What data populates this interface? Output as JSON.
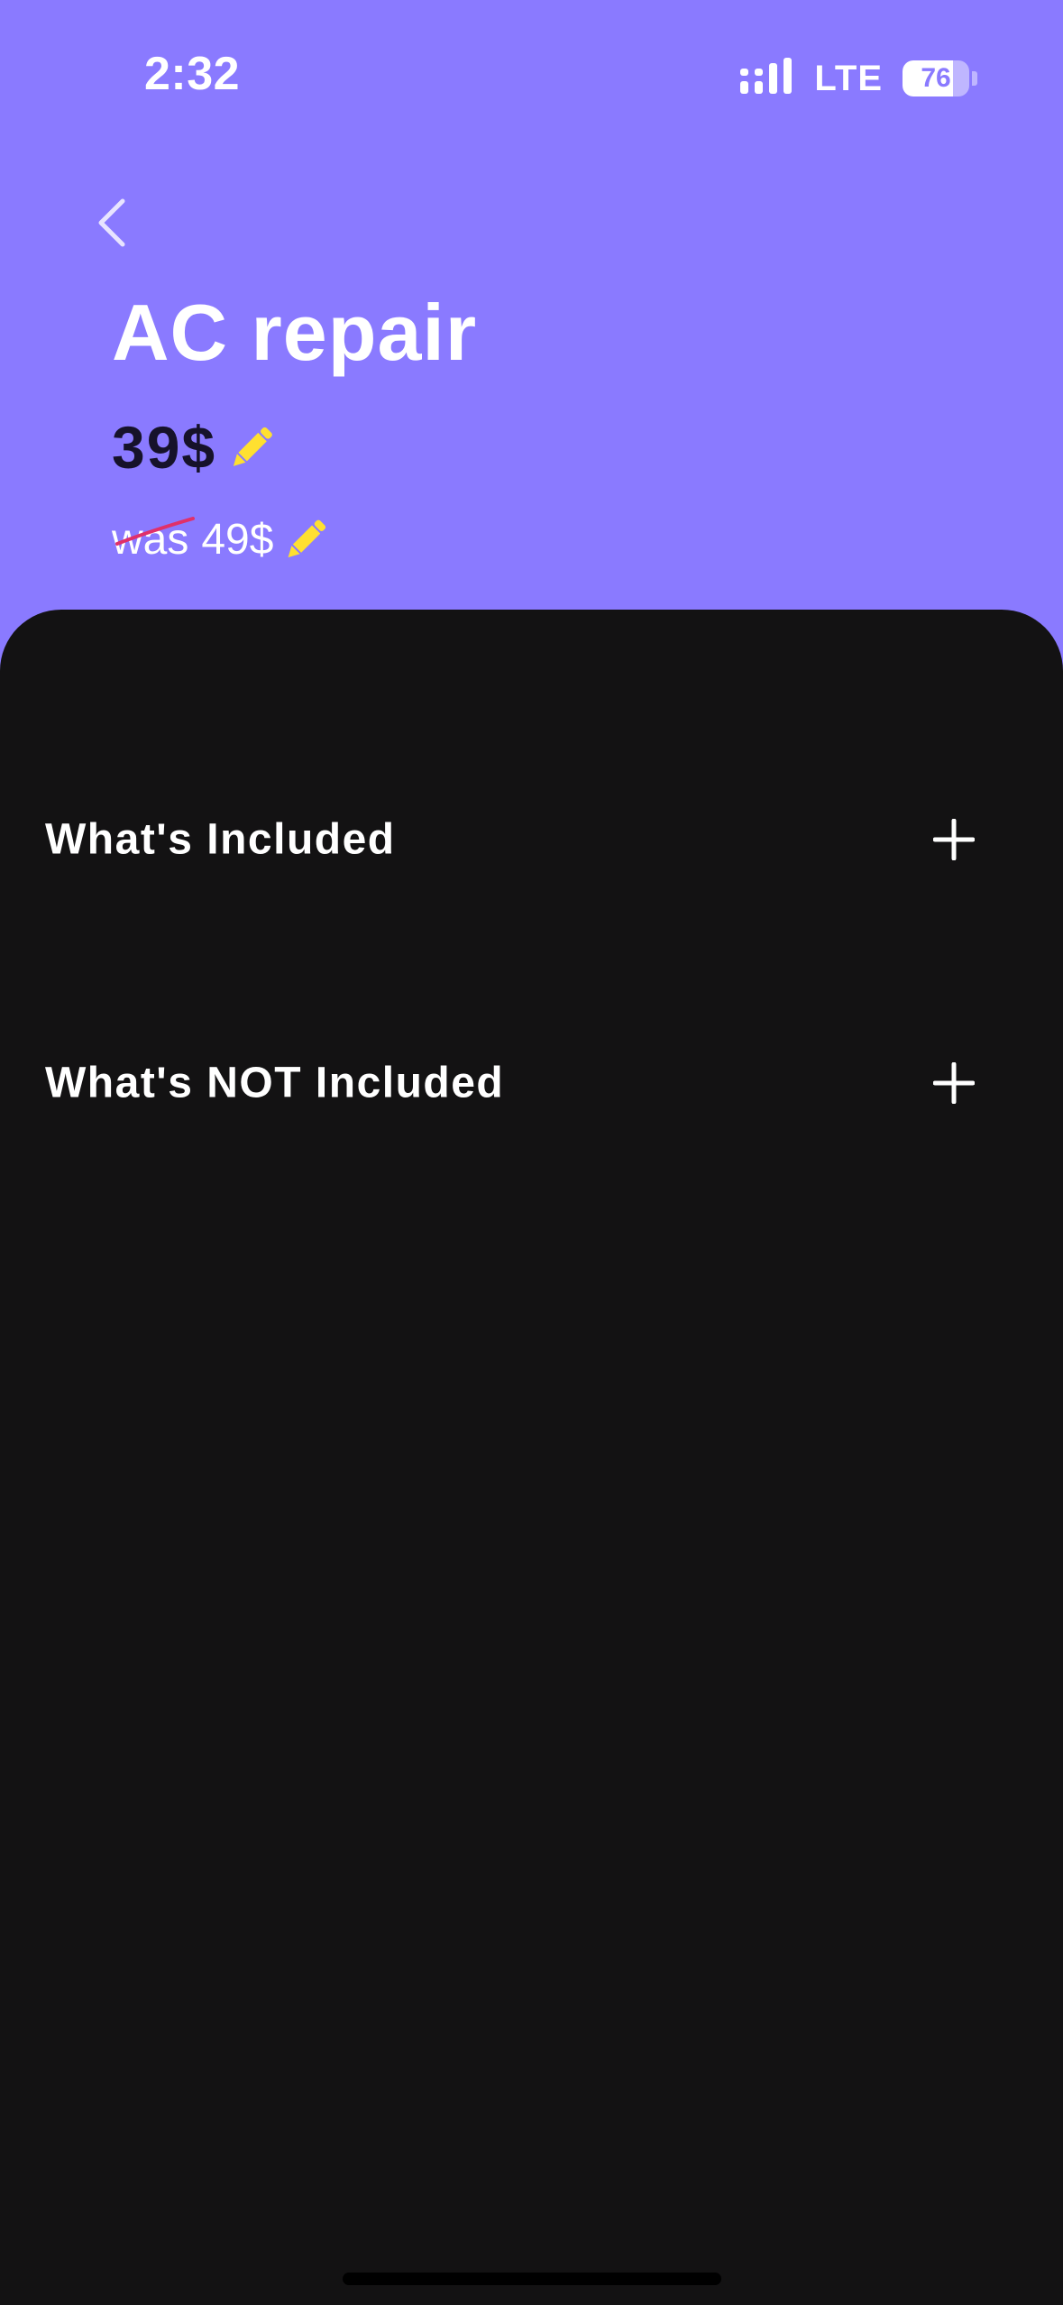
{
  "status_bar": {
    "time": "2:32",
    "network": "LTE",
    "battery_percent": "76",
    "battery_level": 0.76
  },
  "header": {
    "back_icon": "chevron-left-icon",
    "title": "AC repair",
    "price": "39$",
    "old_price_prefix": "was",
    "old_price_value": "49$",
    "edit_icon": "pencil-icon"
  },
  "sections": [
    {
      "label": "What's Included",
      "icon": "plus-icon"
    },
    {
      "label": "What's NOT Included",
      "icon": "plus-icon"
    }
  ],
  "colors": {
    "header_background": "#8a7aff",
    "sheet_background": "#131213",
    "price_text": "#16122a",
    "edit_accent": "#ffe030",
    "strike_through": "#e0306a"
  }
}
